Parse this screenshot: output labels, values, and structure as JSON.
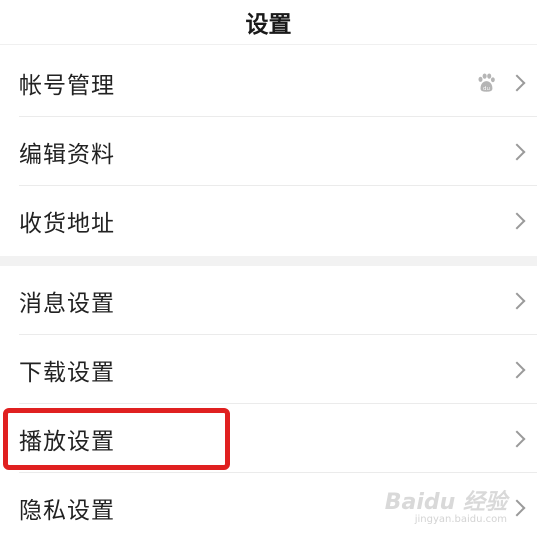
{
  "header": {
    "title": "设置"
  },
  "groups": [
    {
      "items": [
        {
          "label": "帐号管理"
        },
        {
          "label": "编辑资料"
        },
        {
          "label": "收货地址"
        }
      ]
    },
    {
      "items": [
        {
          "label": "消息设置"
        },
        {
          "label": "下载设置"
        },
        {
          "label": "播放设置"
        },
        {
          "label": "隐私设置"
        }
      ]
    }
  ],
  "account_badge_icon": "baidu-paw-icon",
  "highlight_color": "#e02020",
  "watermark": {
    "main": "Baidu 经验",
    "sub": "jingyan.baidu.com"
  }
}
